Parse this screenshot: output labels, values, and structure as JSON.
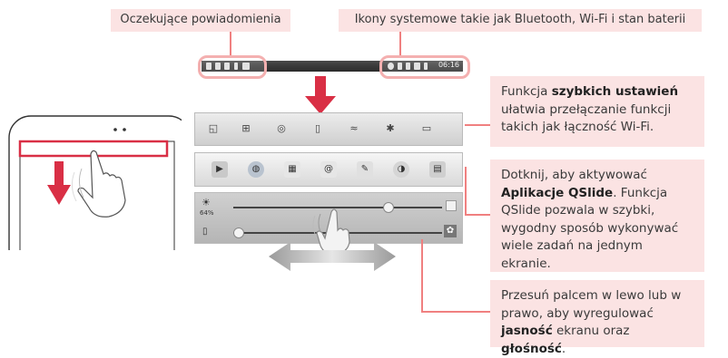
{
  "callouts": {
    "pending_notifications": "Oczekujące powiadomienia",
    "system_icons": "Ikony systemowe takie jak Bluetooth, Wi-Fi i stan baterii",
    "quick_settings": {
      "pre": "Funkcja ",
      "bold": "szybkich ustawień",
      "post": " ułatwia przełączanie funkcji takich jak łączność Wi-Fi."
    },
    "qslide": {
      "pre": "Dotknij, aby aktywować ",
      "bold": "Aplikacje QSlide",
      "post": ". Funkcja QSlide pozwala w szybki, wygodny sposób wykonywać wiele zadań na jednym ekranie."
    },
    "sliders": {
      "pre": "Przesuń palcem w lewo lub w prawo, aby wyregulować ",
      "bold1": "jasność",
      "mid": " ekranu oraz ",
      "bold2": "głośność",
      "post": "."
    }
  },
  "status_bar": {
    "time": "06:16"
  },
  "brightness": {
    "percent_label": "64%",
    "level": 0.74
  },
  "volume": {
    "level": 0.02
  },
  "colors": {
    "accent": "#d92f45",
    "callout_bg": "#fbe3e3",
    "connector": "#f08080"
  }
}
